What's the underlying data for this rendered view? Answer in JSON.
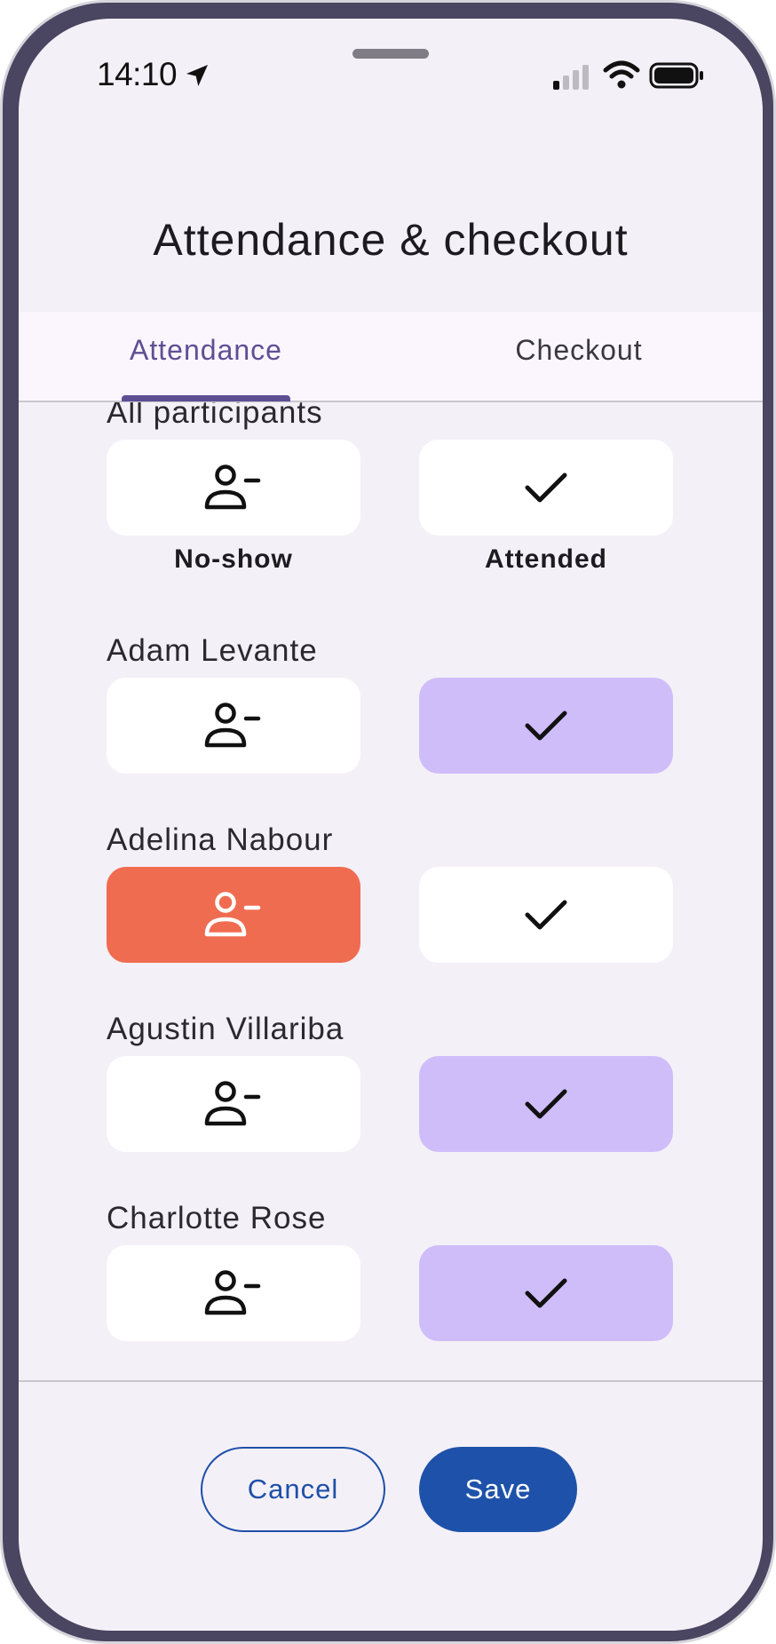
{
  "status_bar": {
    "time": "14:10",
    "icons": [
      "location-arrow-icon",
      "cellular-signal-icon",
      "wifi-icon",
      "battery-icon"
    ]
  },
  "dialog": {
    "title": "Attendance & checkout"
  },
  "tabs": [
    {
      "label": "Attendance",
      "selected": true
    },
    {
      "label": "Checkout",
      "selected": false
    }
  ],
  "all_participants": {
    "label": "All participants",
    "no_show_caption": "No-show",
    "attended_caption": "Attended"
  },
  "participants": [
    {
      "name": "Adam Levante",
      "status": "attended"
    },
    {
      "name": "Adelina Nabour",
      "status": "no-show"
    },
    {
      "name": "Agustin Villariba",
      "status": "attended"
    },
    {
      "name": "Charlotte Rose",
      "status": "attended"
    }
  ],
  "actions": {
    "cancel_label": "Cancel",
    "save_label": "Save"
  },
  "colors": {
    "accent": "#5e4f94",
    "attended_selected": "#cfbdfa",
    "no_show_selected": "#f06c50",
    "primary_button": "#1e52aa",
    "background": "#f4f0f7"
  }
}
